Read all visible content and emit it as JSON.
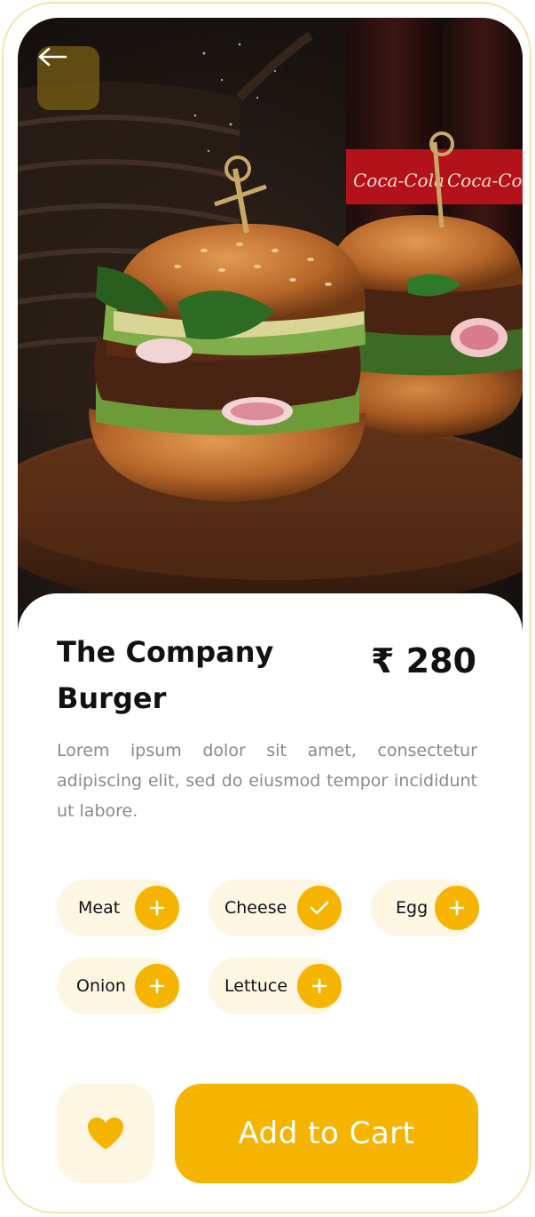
{
  "product": {
    "name": "The Company Burger",
    "price": "₹ 280",
    "description": "Lorem ipsum dolor sit amet, consectetur adipiscing elit, sed do eiusmod tempor incididunt ut labore."
  },
  "toppings": [
    {
      "label": "Meat",
      "state": "add",
      "icon": "plus-icon"
    },
    {
      "label": "Cheese",
      "state": "selected",
      "icon": "check-icon"
    },
    {
      "label": "Egg",
      "state": "add",
      "icon": "plus-icon"
    },
    {
      "label": "Onion",
      "state": "add",
      "icon": "plus-icon"
    },
    {
      "label": "Lettuce",
      "state": "add",
      "icon": "plus-icon"
    }
  ],
  "actions": {
    "add_to_cart_label": "Add to Cart",
    "favorite_icon": "heart-icon",
    "back_icon": "arrow-left-icon"
  },
  "hero": {
    "image": "burger-photo",
    "bottle_labels": [
      "Coca-Cola",
      "Coca-Cola"
    ]
  },
  "colors": {
    "accent": "#f5b400",
    "chip_bg": "#fdf6e3",
    "text": "#111111",
    "muted": "#8a8a8a"
  }
}
